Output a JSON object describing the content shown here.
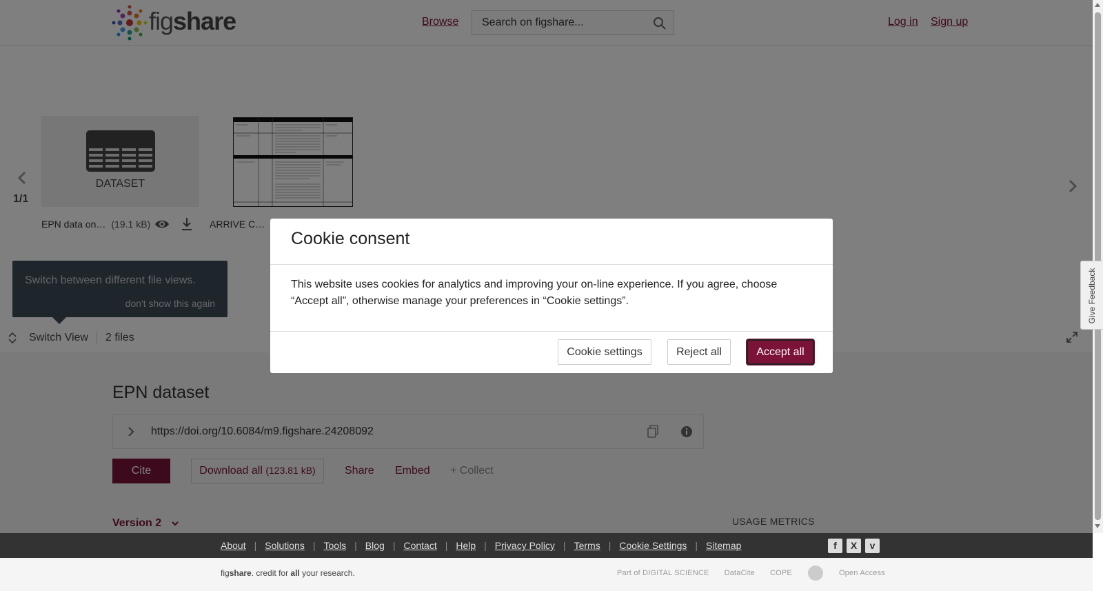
{
  "header": {
    "logo_fig": "fig",
    "logo_share": "share",
    "browse": "Browse",
    "search_placeholder": "Search on figshare...",
    "login": "Log in",
    "signup": "Sign up"
  },
  "viewer": {
    "page_count": "1/1",
    "files": [
      {
        "name": "EPN data on…",
        "size": "(19.1 kB)",
        "thumb_label": "DATASET"
      },
      {
        "name": "ARRIVE C…"
      }
    ],
    "tooltip": {
      "text": "Switch between different file views.",
      "dismiss": "don't show this again"
    },
    "switch_view": "Switch View",
    "files_count": "2 files"
  },
  "article": {
    "title": "EPN dataset",
    "doi": "https://doi.org/10.6084/m9.figshare.24208092",
    "cite": "Cite",
    "download_all": "Download all",
    "download_size": "(123.81 kB)",
    "share": "Share",
    "embed": "Embed",
    "collect": "+ Collect",
    "version": "Version 2",
    "usage_metrics": "USAGE METRICS"
  },
  "footer": {
    "links": [
      "About",
      "Solutions",
      "Tools",
      "Blog",
      "Contact",
      "Help",
      "Privacy Policy",
      "Terms",
      "Cookie Settings",
      "Sitemap"
    ],
    "social": [
      "f",
      "X",
      "v"
    ],
    "tagline_pre": "fig",
    "tagline_share": "share",
    "tagline_mid": ". credit for ",
    "tagline_all": "all",
    "tagline_post": " your research.",
    "partners": [
      "Part of DIGITAL SCIENCE",
      "DataCite",
      "COPE",
      "Open Access"
    ]
  },
  "feedback": "Give Feedback",
  "cookie_modal": {
    "title": "Cookie consent",
    "body": "This website uses cookies for analytics and improving your on-line experience. If you agree, choose “Accept all”, otherwise manage your preferences in “Cookie settings”.",
    "settings": "Cookie settings",
    "reject": "Reject all",
    "accept": "Accept all"
  },
  "colors": {
    "brand": "#7b1238",
    "footer_bg": "#333333",
    "tooltip_bg": "#3d4a57"
  }
}
